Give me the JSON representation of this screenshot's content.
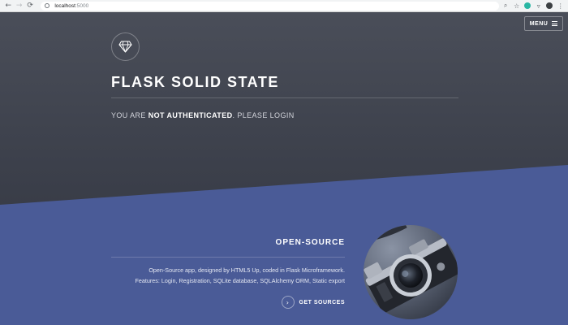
{
  "browser": {
    "url_host": "localhost",
    "url_port": ":5000",
    "back": "←",
    "forward": "→",
    "reload": "⟳"
  },
  "header": {
    "menu_label": "MENU",
    "logo_icon": "diamond-icon"
  },
  "hero": {
    "title": "FLASK SOLID STATE",
    "auth_prefix": "YOU ARE ",
    "auth_bold": "NOT AUTHENTICATED",
    "auth_suffix": ". PLEASE LOGIN"
  },
  "feature": {
    "title": "OPEN-SOURCE",
    "line1": "Open-Source app, designed by HTML5 Up, coded in Flask Microframework.",
    "line2": "Features: Login, Registration, SQLite database, SQLAlchemy ORM, Static export",
    "button_label": "GET SOURCES",
    "image_subject": "vintage-camera"
  },
  "colors": {
    "hero_dark": "#3d414c",
    "accent_blue": "#4a5b97"
  }
}
